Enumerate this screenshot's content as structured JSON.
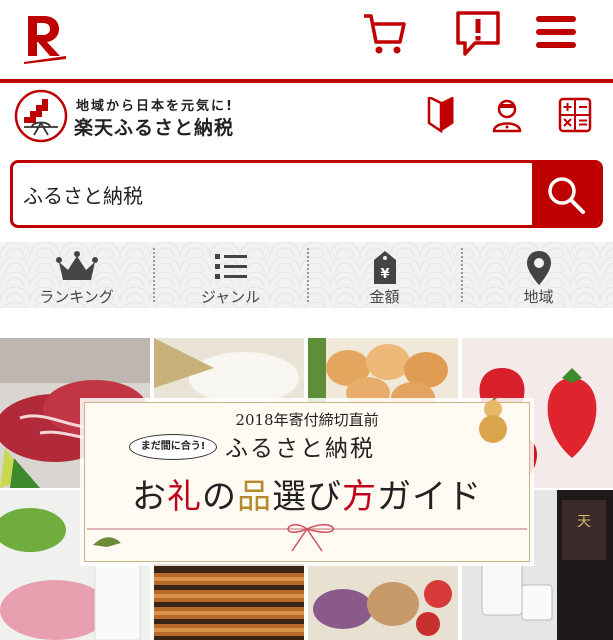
{
  "topbar": {
    "logo_icon": "rakuten-r-logo",
    "icons": [
      "cart-icon",
      "alert-icon",
      "hamburger-menu-icon"
    ],
    "brand_color": "#bf0000"
  },
  "site_header": {
    "tagline": "地域から日本を元気に!",
    "site_name": "楽天ふるさと納税",
    "icons": [
      "beginner-mark-icon",
      "user-icon",
      "calculator-icon"
    ]
  },
  "search": {
    "value": "ふるさと納税",
    "button_icon": "search-icon"
  },
  "category_nav": {
    "items": [
      {
        "label": "ランキング",
        "icon": "crown-icon"
      },
      {
        "label": "ジャンル",
        "icon": "list-icon"
      },
      {
        "label": "金額",
        "icon": "yen-tag-icon"
      },
      {
        "label": "地域",
        "icon": "map-pin-icon"
      }
    ]
  },
  "banner": {
    "year_line": "2018年寄付締切直前",
    "badge": "まだ間に合う!",
    "title": "ふるさと納税",
    "guide_parts": [
      "お",
      "礼",
      "の",
      "品",
      "選び",
      "方",
      "ガイド"
    ]
  }
}
